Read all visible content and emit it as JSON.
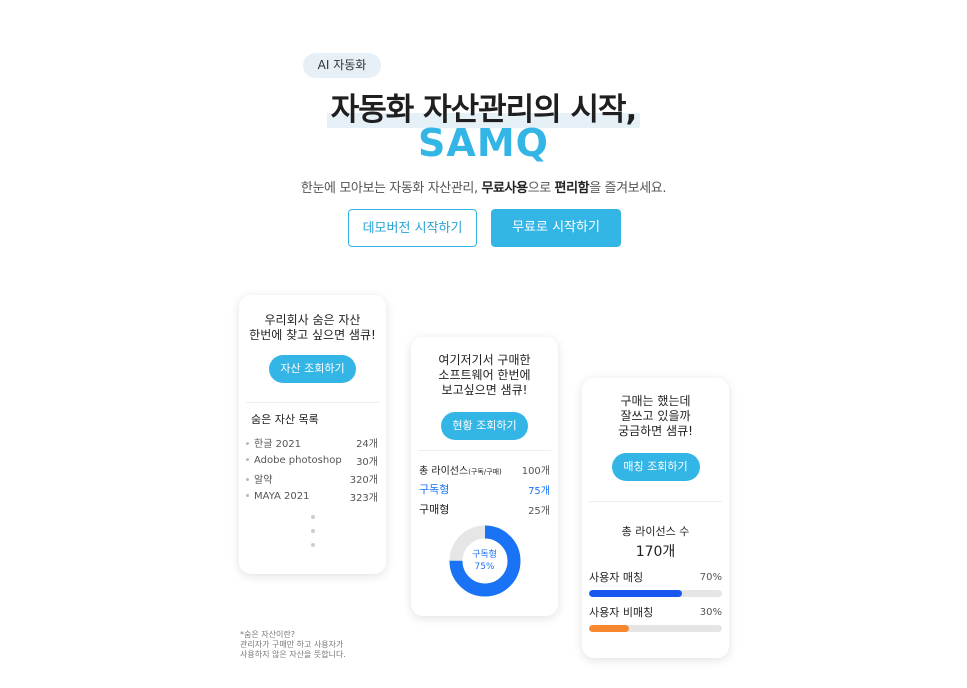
{
  "hero": {
    "badge": "AI 자동화",
    "headline": "자동화 자산관리의 시작,",
    "brand": "SAMQ",
    "sub_pre": "한눈에 모아보는 자동화 자산관리, ",
    "sub_b1": "무료사용",
    "sub_mid": "으로 ",
    "sub_b2": "편리함",
    "sub_post": "을 즐겨보세요.",
    "btn_demo": "데모버전 시작하기",
    "btn_free": "무료로 시작하기"
  },
  "card1": {
    "line1": "우리회사 숨은 자산",
    "line2": "한번에 찾고 싶으면 샘큐!",
    "button": "자산 조회하기",
    "list_title": "숨은 자산 목록",
    "items": [
      {
        "name": "한글 2021",
        "count": "24개"
      },
      {
        "name": "Adobe photoshop",
        "count": "30개"
      },
      {
        "name": "알약",
        "count": "320개"
      },
      {
        "name": "MAYA 2021",
        "count": "323개"
      }
    ]
  },
  "card2": {
    "line1": "여기저기서 구매한",
    "line2": "소프트웨어 한번에",
    "line3": "보고싶으면 샘큐!",
    "button": "현황 조회하기",
    "total_label": "총 라이선스",
    "total_sub": "(구독/구매)",
    "total_count": "100개",
    "sub_label": "구독형",
    "sub_count": "75개",
    "buy_label": "구매형",
    "buy_count": "25개",
    "donut_label": "구독형",
    "donut_pct": "75%",
    "donut_value": 0.75,
    "donut_color": "#1a73f5"
  },
  "card3": {
    "line1": "구매는 했는데",
    "line2": "잘쓰고 있을까",
    "line3": "궁금하면 샘큐!",
    "button": "매칭 조회하기",
    "total_label": "총 라이선스 수",
    "total_count": "170개",
    "match_label": "사용자 매칭",
    "match_pct": "70%",
    "match_value": 0.7,
    "match_color": "#1a56f0",
    "unmatch_label": "사용자 비매칭",
    "unmatch_pct": "30%",
    "unmatch_value": 0.3,
    "unmatch_color": "#f7882f"
  },
  "footnote": {
    "line1": "*숨은 자산이란?",
    "line2": "관리자가 구매만 하고 사용자가",
    "line3": "사용하지 않은 자산을 뜻합니다."
  },
  "colors": {
    "accent": "#33b5e5"
  }
}
